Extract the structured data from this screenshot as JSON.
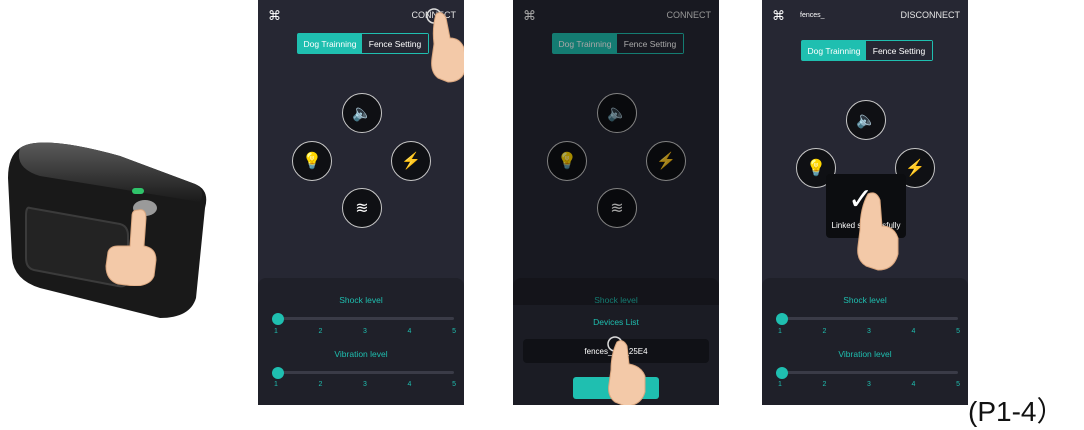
{
  "labels": {
    "top_partial": "(P1-4)",
    "bottom": "(P1-4）"
  },
  "screens": [
    {
      "menu_icon": "grid-icon",
      "right_action": "CONNECT",
      "tabs": [
        "Dog Trainning",
        "Fence Setting"
      ],
      "shock_title": "Shock level",
      "vibration_title": "Vibration level",
      "ticks": [
        "1",
        "2",
        "3",
        "4",
        "5"
      ],
      "shock_value": 1,
      "vibration_value": 1
    },
    {
      "menu_icon": "grid-icon",
      "right_action": "CONNECT",
      "tabs": [
        "Dog Trainning",
        "Fence Setting"
      ],
      "shock_title": "Shock level",
      "devices_title": "Devices List",
      "device_name": "fences_ally_25E4"
    },
    {
      "menu_icon": "grid-icon",
      "device_label": "fences_",
      "right_action": "DISCONNECT",
      "tabs": [
        "Dog Trainning",
        "Fence Setting"
      ],
      "toast": "Linked successfully",
      "shock_title": "Shock level",
      "vibration_title": "Vibration level",
      "ticks": [
        "1",
        "2",
        "3",
        "4",
        "5"
      ],
      "shock_value": 1,
      "vibration_value": 1
    }
  ],
  "icons": {
    "sound": "speaker-icon",
    "light": "bulb-icon",
    "shock": "lightning-icon",
    "vibrate": "vibration-icon"
  },
  "colors": {
    "accent": "#1fbfb0",
    "screen_bg": "#262733",
    "panel_bg": "#1f2029"
  }
}
